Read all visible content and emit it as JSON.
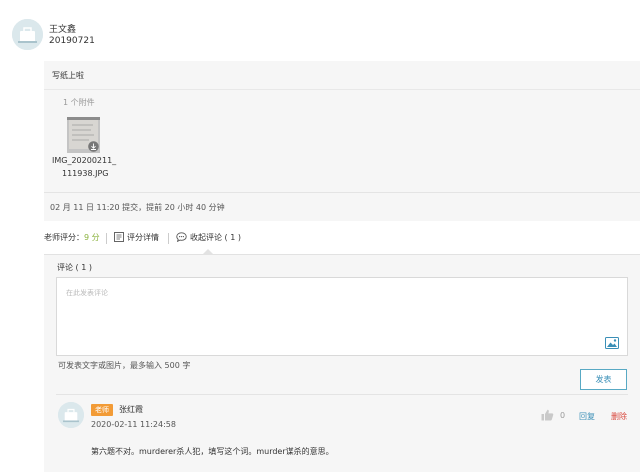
{
  "header": {
    "name": "王文鑫",
    "id": "20190721"
  },
  "submission": {
    "title": "写纸上啦",
    "attachment_count": "1 个附件",
    "attachment_name_line1": "IMG_20200211_",
    "attachment_name_line2": "111938.JPG",
    "submit_info": "02 月 11 日 11:20 提交，提前 20 小时 40 分钟"
  },
  "tabs": {
    "score_label": "老师评分：",
    "score_value": "9 分",
    "detail_label": "评分详情",
    "comments_label": "收起评论 ( 1 )"
  },
  "comments": {
    "title": "评论 ( 1 )",
    "placeholder": "在此发表评论",
    "hint": "可发表文字或图片，最多输入 500 字",
    "publish_label": "发表",
    "items": [
      {
        "role": "老师",
        "author": "张红霞",
        "time": "2020-02-11 11:24:58",
        "likes": "0",
        "reply_label": "回复",
        "delete_label": "删除",
        "text": "第六题不对。murderer杀人犯，填写这个词。murder谋杀的意思。"
      }
    ]
  },
  "colors": {
    "accent": "#3a8fb7",
    "score": "#8bb33f",
    "role_badge": "#f29b36",
    "delete": "#d9463b",
    "panel_bg": "#f6f6f6"
  },
  "icons": {
    "avatar": "bag-avatar-icon",
    "detail": "list-icon",
    "comments": "chat-bubble-icon",
    "image": "image-icon",
    "like": "thumbs-up-icon",
    "download": "download-icon"
  }
}
